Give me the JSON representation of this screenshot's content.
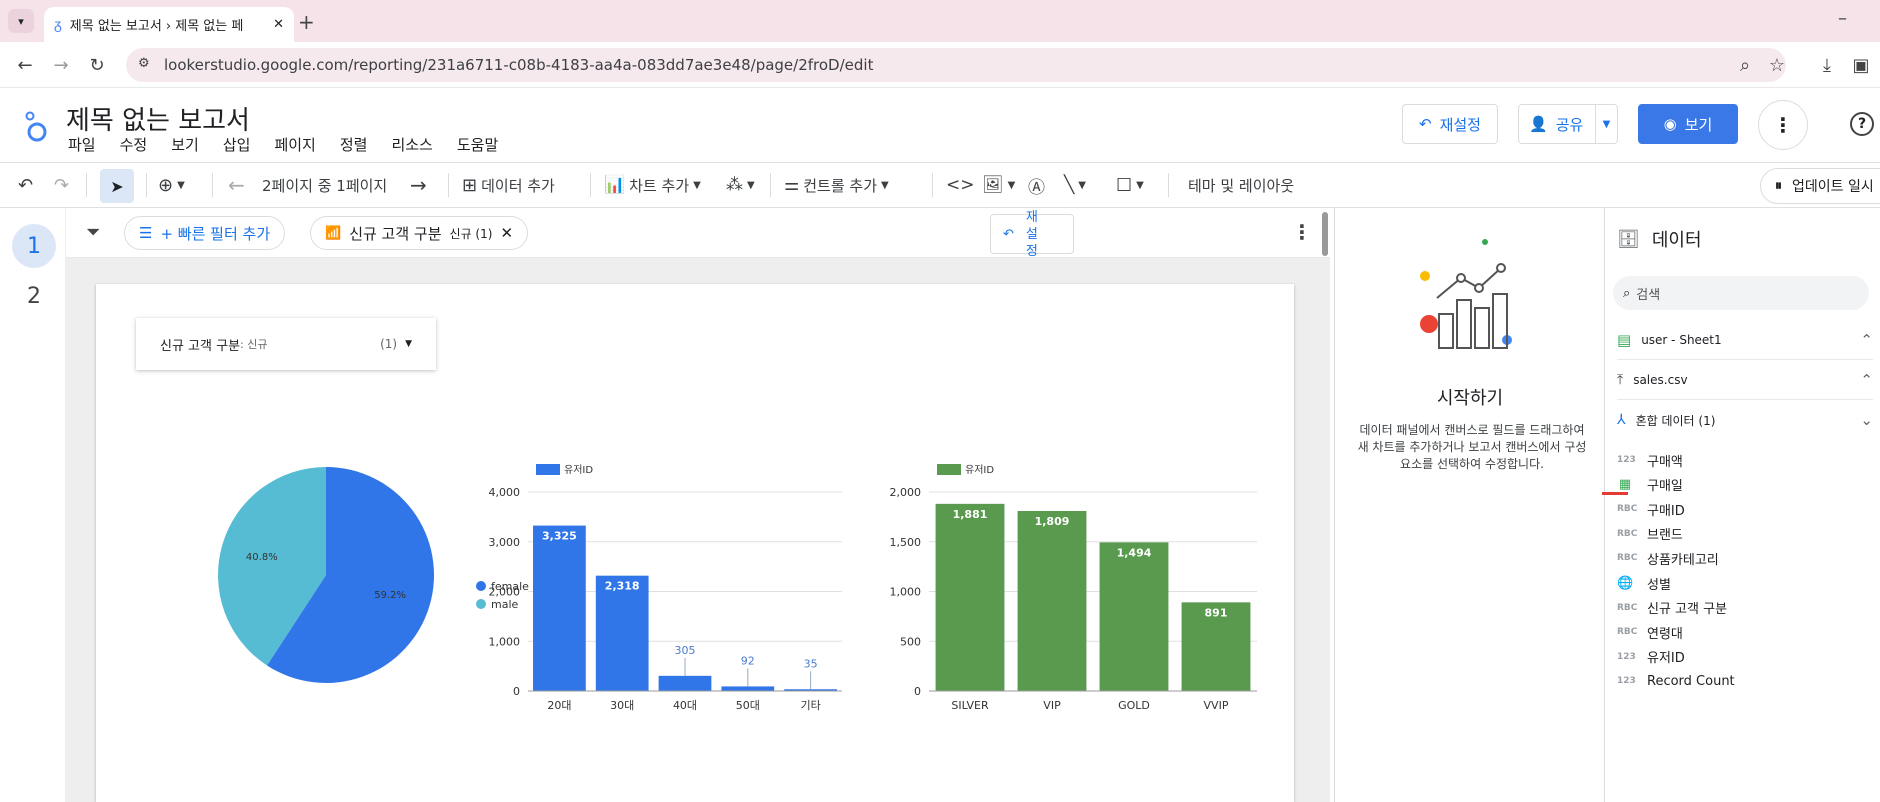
{
  "browser": {
    "tab_title": "제목 없는 보고서 › 제목 없는 페",
    "url": "lookerstudio.google.com/reporting/231a6711-c08b-4183-aa4a-083dd7ae3e48/page/2froD/edit"
  },
  "app": {
    "title": "제목 없는 보고서",
    "menus": [
      "파일",
      "수정",
      "보기",
      "삽입",
      "페이지",
      "정렬",
      "리소스",
      "도움말"
    ],
    "reset_label": "재설정",
    "share_label": "공유",
    "view_label": "보기",
    "help_icon": "help-icon"
  },
  "toolbar": {
    "page_nav": "2페이지 중 1페이지",
    "add_data": "데이터 추가",
    "add_chart": "차트 추가",
    "add_control": "컨트롤 추가",
    "theme_layout": "테마 및 레이아웃",
    "update_pause": "업데이트 일시"
  },
  "pages": [
    "1",
    "2"
  ],
  "filterbar": {
    "quick_filter": "+ 빠른 필터 추가",
    "chip_label": "신규 고객 구분",
    "chip_value": "신규 (1)",
    "reset_label": "재설정"
  },
  "control": {
    "label": "신규 고객 구분",
    "value": ": 신규",
    "count": "(1)"
  },
  "chart_data": [
    {
      "type": "pie",
      "categories": [
        "female",
        "male"
      ],
      "values": [
        59.2,
        40.8
      ],
      "labels": [
        "59.2%",
        "40.8%"
      ],
      "colors": [
        "#3176e8",
        "#56bcd3"
      ],
      "legend": "right"
    },
    {
      "type": "bar",
      "series": [
        {
          "name": "유저ID",
          "values": [
            3325,
            2318,
            305,
            92,
            35
          ]
        }
      ],
      "categories": [
        "20대",
        "30대",
        "40대",
        "50대",
        "기타"
      ],
      "value_labels": [
        "3,325",
        "2,318",
        "305",
        "92",
        "35"
      ],
      "yticks": [
        "0",
        "1,000",
        "2,000",
        "3,000",
        "4,000"
      ],
      "ylim": [
        0,
        4000
      ],
      "color": "#3176e8",
      "legend": "top-left"
    },
    {
      "type": "bar",
      "series": [
        {
          "name": "유저ID",
          "values": [
            1881,
            1809,
            1494,
            891
          ]
        }
      ],
      "categories": [
        "SILVER",
        "VIP",
        "GOLD",
        "VVIP"
      ],
      "value_labels": [
        "1,881",
        "1,809",
        "1,494",
        "891"
      ],
      "yticks": [
        "0",
        "500",
        "1,000",
        "1,500",
        "2,000"
      ],
      "ylim": [
        0,
        2000
      ],
      "color": "#5a9a4e",
      "legend": "top-left"
    }
  ],
  "start_panel": {
    "title": "시작하기",
    "description": "데이터 패널에서 캔버스로 필드를 드래그하여 새 차트를 추가하거나 보고서 캔버스에서 구성요소를 선택하여 수정합니다."
  },
  "data_panel": {
    "title": "데이터",
    "search_placeholder": "검색",
    "sources": [
      {
        "name": "user - Sheet1",
        "icon": "sheets-icon"
      },
      {
        "name": "sales.csv",
        "icon": "upload-icon"
      },
      {
        "name": "혼합 데이터 (1)",
        "icon": "blend-icon"
      }
    ],
    "fields": [
      {
        "type": "123",
        "name": "구매액"
      },
      {
        "type": "date",
        "name": "구매일"
      },
      {
        "type": "RBC",
        "name": "구매ID"
      },
      {
        "type": "RBC",
        "name": "브랜드"
      },
      {
        "type": "RBC",
        "name": "상품카테고리"
      },
      {
        "type": "geo",
        "name": "성별"
      },
      {
        "type": "RBC",
        "name": "신규 고객 구분"
      },
      {
        "type": "RBC",
        "name": "연령대"
      },
      {
        "type": "123",
        "name": "유저ID"
      },
      {
        "type": "123",
        "name": "Record Count"
      }
    ]
  }
}
